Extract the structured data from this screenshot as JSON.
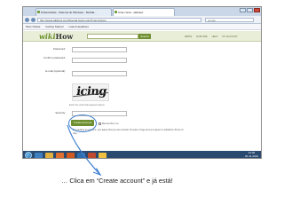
{
  "browser": {
    "tabs": [
      "M Recebidas - Sistema do Windows - Mozilla...",
      "Criar conta - wikiHow"
    ],
    "url": "http://www.wikihow.com/Special:UserLogin?type=signup",
    "search_placeholder": "google",
    "bookmarks": [
      "Most Visited",
      "Getting Started",
      "Latest Headlines"
    ]
  },
  "site": {
    "logo_wiki": "wiki",
    "logo_how": "How",
    "search_button": "Search",
    "nav": [
      "WRITE",
      "EXPLORE",
      "HELP",
      "MY ACCOUNT"
    ]
  },
  "form": {
    "password_label": "Password:",
    "confirm_label": "Confirm password:",
    "email_label": "E-mail (optional):",
    "captcha_text": "icing",
    "captcha_note": "Enter the word that appears above",
    "security_label": "Security:",
    "create_button": "Create Account",
    "remember_label": "Remember me",
    "terms_text": "By creating an account, you agree that you are at least 13 years of age and you agree to wikiHow's Terms of Use."
  },
  "taskbar": {
    "time": "12:30",
    "date": "26-11-2010"
  },
  "caption": "… Clica em “Create account” e já está!",
  "colors": {
    "pointer": "#3f7fd0",
    "site_green": "#6e8f2f"
  }
}
